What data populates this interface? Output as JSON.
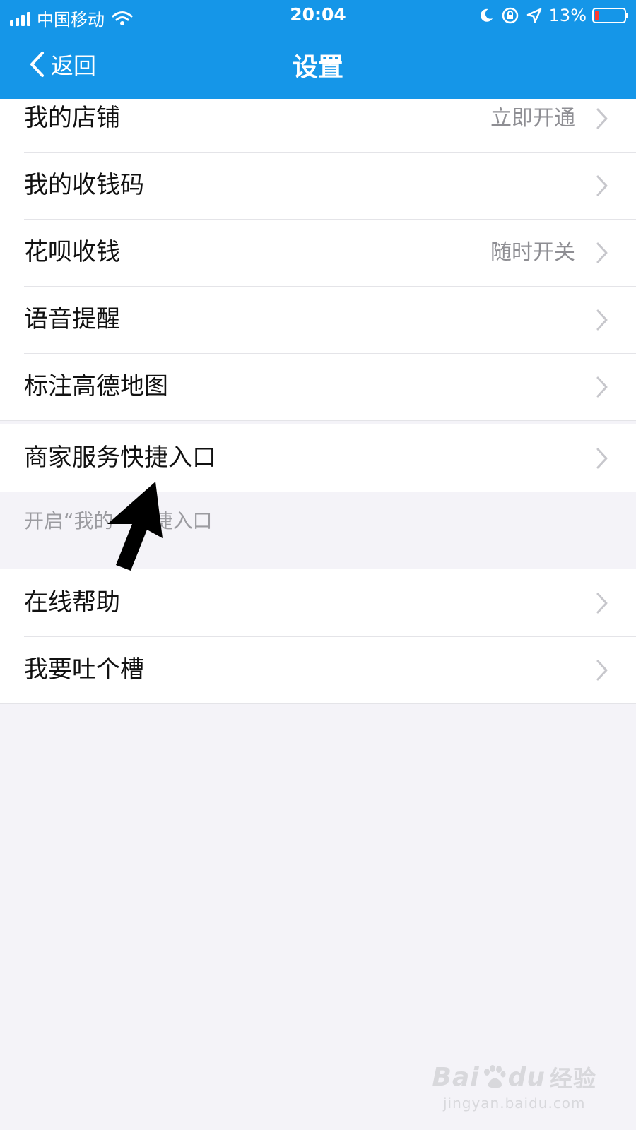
{
  "status_bar": {
    "carrier": "中国移动",
    "time": "20:04",
    "battery_percent": "13%",
    "battery_level": 0.13,
    "icons": [
      "signal-icon",
      "wifi-icon",
      "moon-icon",
      "rotation-lock-icon",
      "location-icon",
      "battery-icon"
    ]
  },
  "nav": {
    "back_label": "返回",
    "title": "设置"
  },
  "groups": [
    {
      "items": [
        {
          "label": "我的店铺",
          "value": "立即开通"
        },
        {
          "label": "我的收钱码",
          "value": ""
        },
        {
          "label": "花呗收钱",
          "value": "随时开关"
        },
        {
          "label": "语音提醒",
          "value": ""
        },
        {
          "label": "标注高德地图",
          "value": ""
        }
      ]
    },
    {
      "items": [
        {
          "label": "商家服务快捷入口",
          "value": ""
        }
      ],
      "footnote": "开启“我的　　捷入口"
    },
    {
      "items": [
        {
          "label": "在线帮助",
          "value": ""
        },
        {
          "label": "我要吐个槽",
          "value": ""
        }
      ]
    }
  ],
  "colors": {
    "header": "#1596e8",
    "background": "#f4f3f8",
    "chevron": "#c7c7cc",
    "battery_low": "#ff3b30"
  },
  "watermark": {
    "logo_text": "Bai",
    "logo_text_2": "du",
    "logo_cn": "经验",
    "url": "jingyan.baidu.com"
  }
}
